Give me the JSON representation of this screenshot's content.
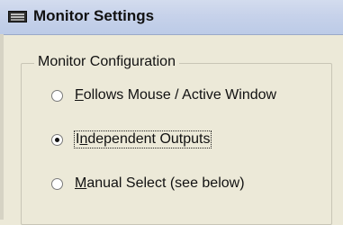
{
  "window": {
    "title": "Monitor Settings",
    "title_icon": "monitor-settings-icon"
  },
  "group": {
    "legend": "Monitor Configuration",
    "options": [
      {
        "mnemonic": "F",
        "rest": "ollows Mouse / Active Window",
        "checked": false
      },
      {
        "pre": "I",
        "mnemonic": "n",
        "rest": "dependent Outputs",
        "checked": true,
        "focused": true
      },
      {
        "mnemonic": "M",
        "rest": "anual Select (see below)",
        "checked": false
      }
    ]
  },
  "colors": {
    "dialog_bg": "#ece9d8",
    "titlebar": "#c7d2ea",
    "text": "#111111"
  }
}
